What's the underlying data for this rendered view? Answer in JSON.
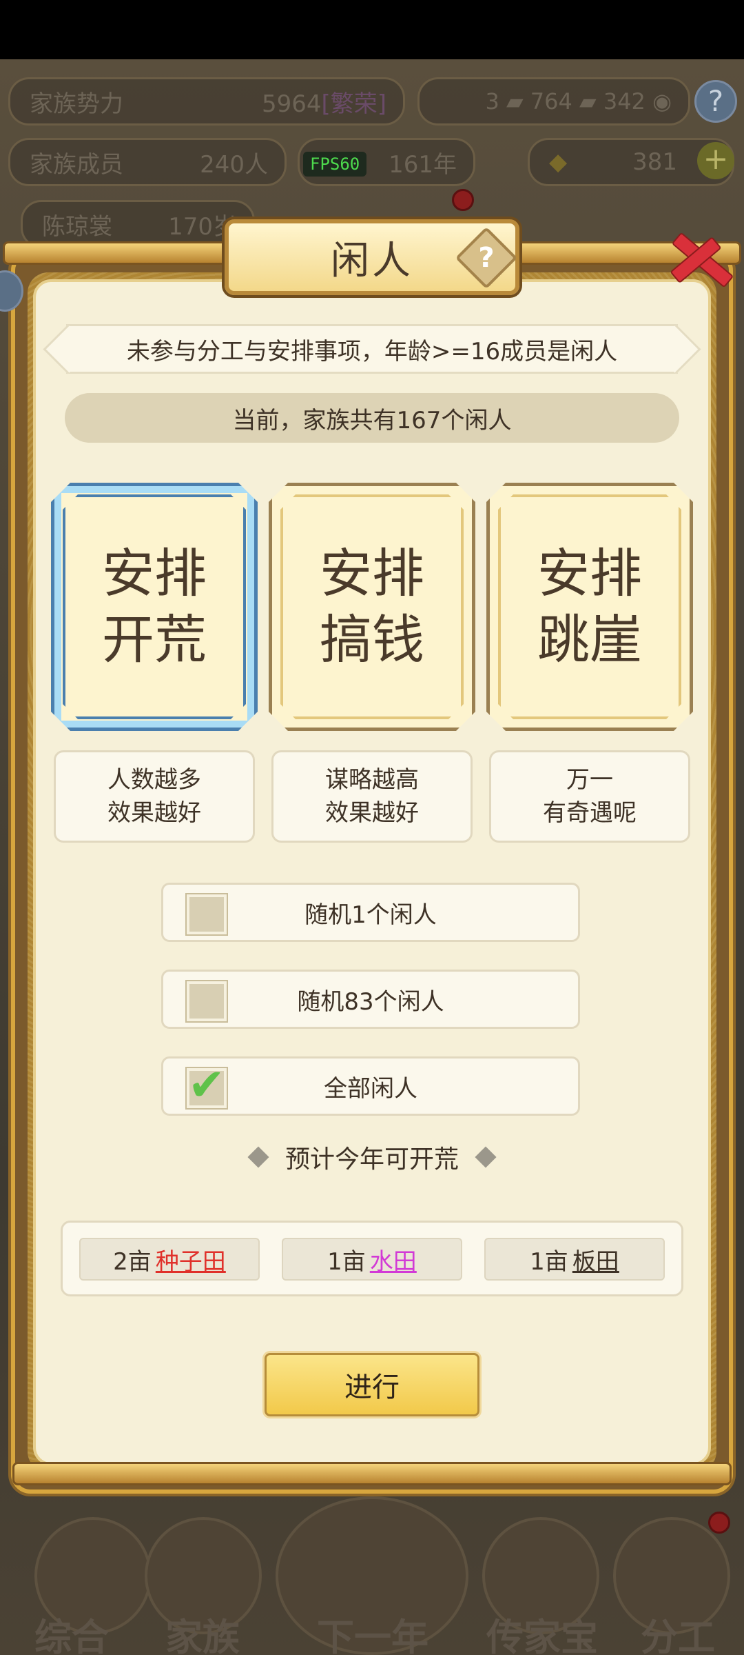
{
  "hud": {
    "power_label": "家族势力",
    "power_value": "5964",
    "power_rank": "[繁荣]",
    "currency_a": "3",
    "currency_b": "764",
    "currency_c": "342",
    "members_label": "家族成员",
    "members_value": "240人",
    "fps": "FPS60",
    "year_value": "161年",
    "gold_value": "381",
    "person_label": "陈琼裳",
    "person_age": "170岁"
  },
  "dialog": {
    "title": "闲人",
    "help_icon": "?",
    "description": "未参与分工与安排事项，年龄>=16成员是闲人",
    "current_count": "当前，家族共有167个闲人",
    "cards": [
      {
        "label": "安排\n开荒",
        "line1": "安排",
        "line2": "开荒",
        "selected": true
      },
      {
        "label": "安排\n搞钱",
        "line1": "安排",
        "line2": "搞钱",
        "selected": false
      },
      {
        "label": "安排\n跳崖",
        "line1": "安排",
        "line2": "跳崖",
        "selected": false
      }
    ],
    "hints": [
      {
        "line1": "人数越多",
        "line2": "效果越好"
      },
      {
        "line1": "谋略越高",
        "line2": "效果越好"
      },
      {
        "line1": "万一",
        "line2": "有奇遇呢"
      }
    ],
    "options": [
      {
        "label": "随机1个闲人",
        "checked": false
      },
      {
        "label": "随机83个闲人",
        "checked": false
      },
      {
        "label": "全部闲人",
        "checked": true
      }
    ],
    "forecast": "预计今年可开荒",
    "yields": [
      {
        "amount": "2亩",
        "type": "种子田",
        "color": "#e0302a"
      },
      {
        "amount": "1亩",
        "type": "水田",
        "color": "#d23ad6"
      },
      {
        "amount": "1亩",
        "type": "板田",
        "color": "#3e3226"
      }
    ],
    "proceed_label": "进行"
  },
  "nav": {
    "items": [
      "综合",
      "家族",
      "下一年",
      "传家宝",
      "分工"
    ]
  },
  "colors": {
    "accent_gold": "#f2c94a",
    "selected_blue": "#a9dcf5",
    "check_green": "#5fc24a",
    "close_red": "#d9303a"
  }
}
